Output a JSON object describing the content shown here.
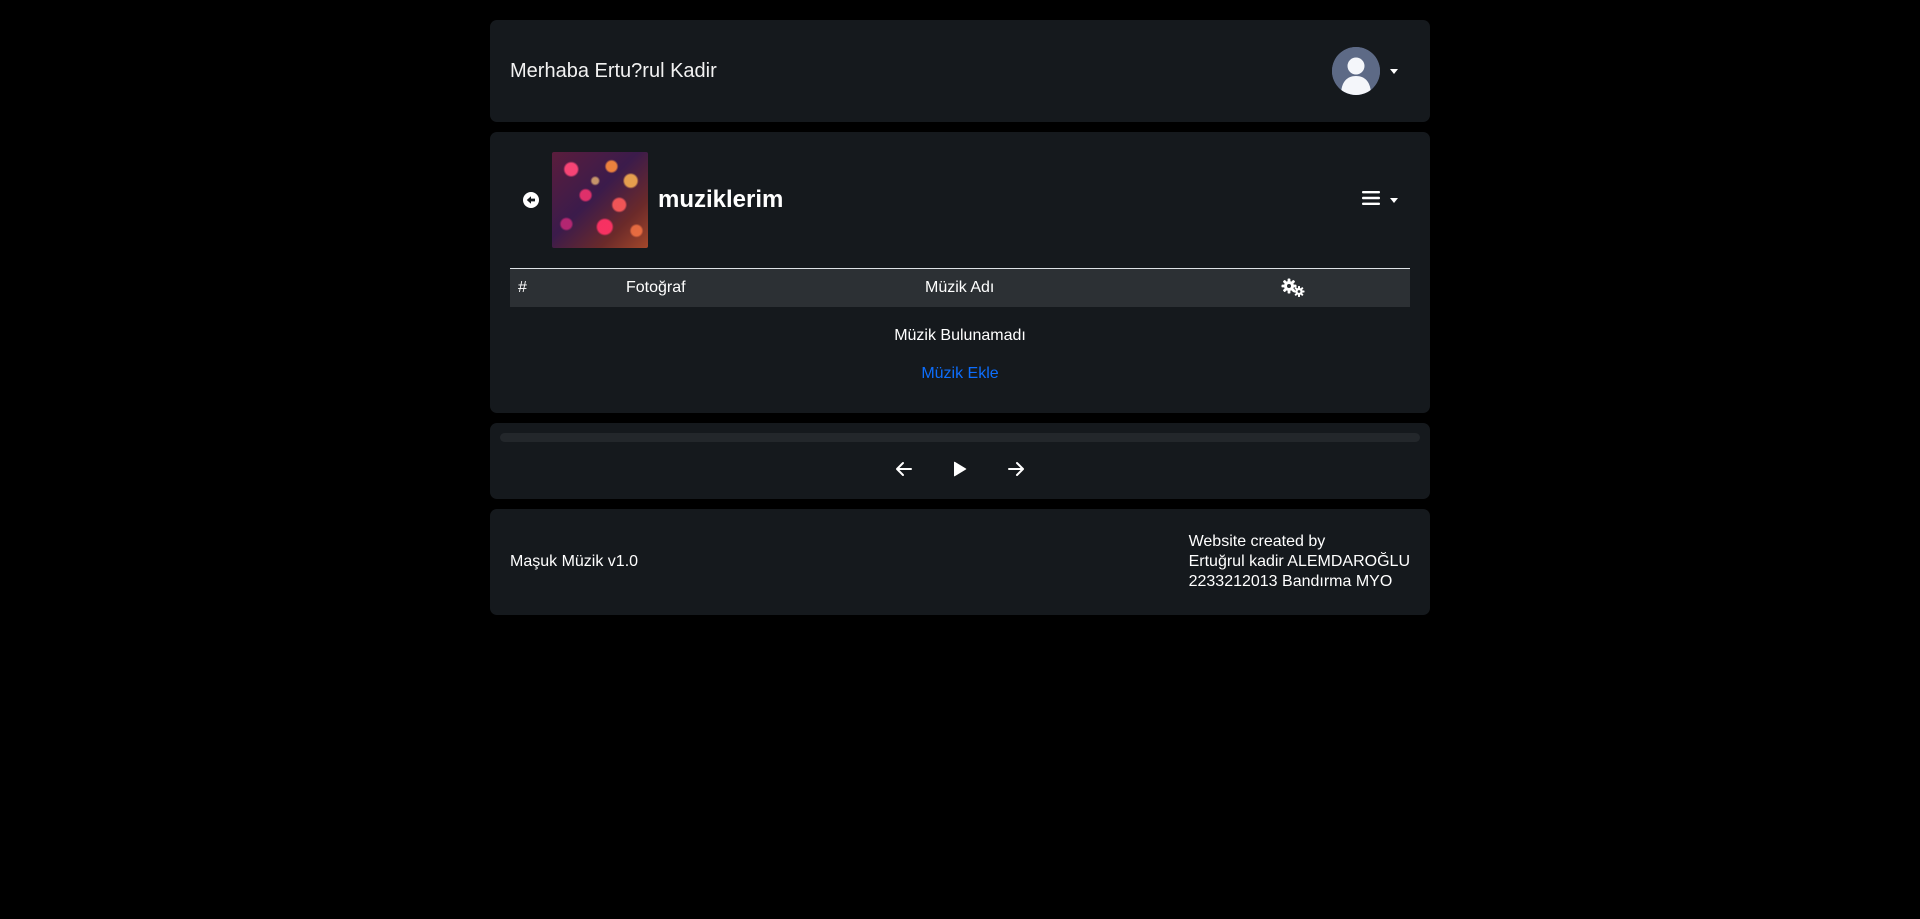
{
  "header": {
    "greeting": "Merhaba Ertu?rul Kadir",
    "avatar_icon": "user-avatar-icon"
  },
  "playlist": {
    "title": "muziklerim",
    "back_icon": "arrow-left-circle-icon",
    "menu_icon": "hamburger-menu-icon",
    "table": {
      "columns": [
        "#",
        "Fotoğraf",
        "Müzik Adı"
      ],
      "settings_icon": "gears-icon",
      "rows": []
    },
    "empty_message": "Müzik Bulunamadı",
    "add_link": "Müzik Ekle"
  },
  "player": {
    "progress": 0,
    "controls": [
      "previous-icon",
      "play-icon",
      "next-icon"
    ]
  },
  "footer": {
    "app_name": "Maşuk Müzik v1.0",
    "credit_line1": "Website created by",
    "credit_line2": "Ertuğrul kadir ALEMDAROĞLU",
    "credit_line3": "2233212013 Bandırma MYO"
  },
  "colors": {
    "background": "#000000",
    "card": "#15191d",
    "table_header": "#2c3034",
    "link": "#0d6efd",
    "avatar": "#5d6a86"
  }
}
